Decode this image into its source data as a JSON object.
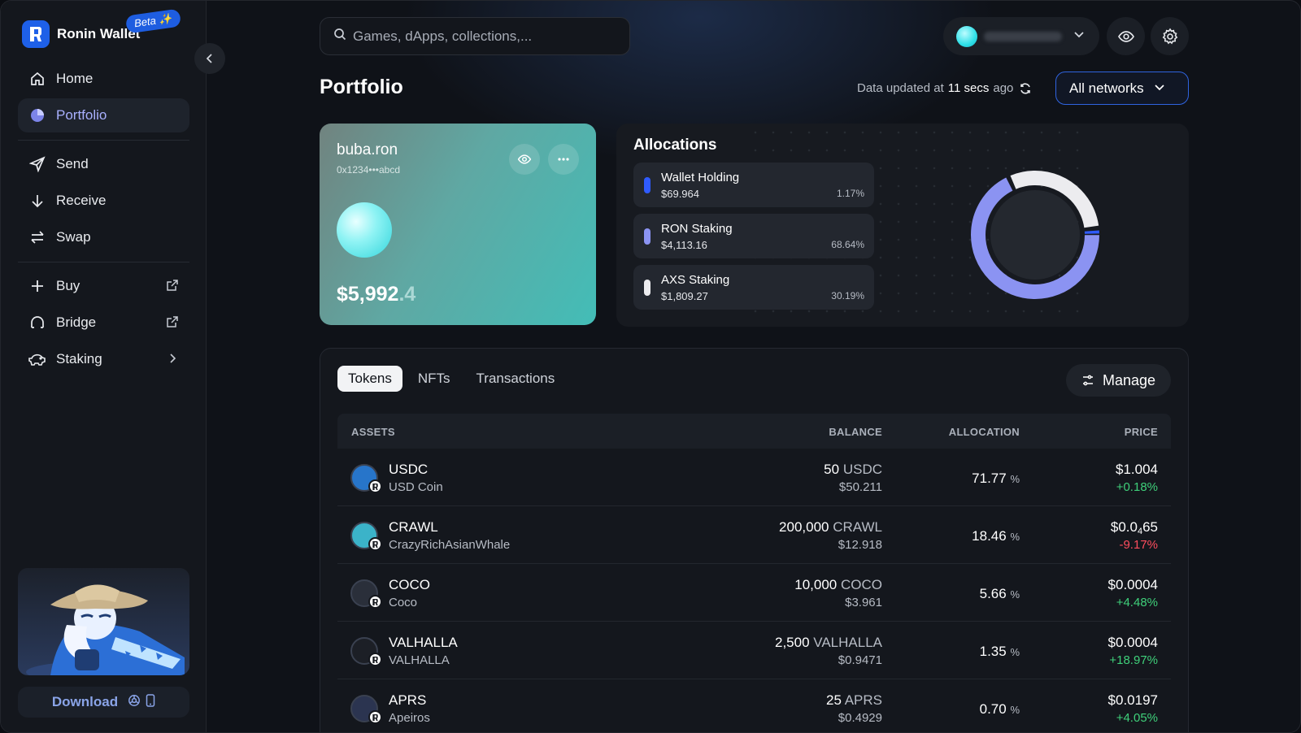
{
  "app": {
    "name": "Ronin Wallet",
    "beta": "Beta ✨"
  },
  "sidebar": {
    "items": [
      {
        "label": "Home",
        "icon": "home-icon"
      },
      {
        "label": "Portfolio",
        "icon": "pie-chart-icon",
        "active": true
      },
      {
        "label": "Send",
        "icon": "send-icon"
      },
      {
        "label": "Receive",
        "icon": "arrow-down-icon"
      },
      {
        "label": "Swap",
        "icon": "swap-icon"
      },
      {
        "label": "Buy",
        "icon": "plus-icon",
        "trail": "external-link-icon"
      },
      {
        "label": "Bridge",
        "icon": "bridge-icon",
        "trail": "external-link-icon"
      },
      {
        "label": "Staking",
        "icon": "piggy-bank-icon",
        "trail": "chevron-right-icon"
      }
    ],
    "download_label": "Download"
  },
  "topbar": {
    "search_placeholder": "Games, dApps, collections,..."
  },
  "page": {
    "title": "Portfolio",
    "updated_prefix": "Data updated at",
    "updated_value": "11 secs",
    "updated_suffix": "ago",
    "network_select": "All networks"
  },
  "account_card": {
    "name": "buba.ron",
    "address": "0x1234•••abcd",
    "balance_main": "$5,992",
    "balance_decimal": ".4"
  },
  "allocations": {
    "title": "Allocations",
    "items": [
      {
        "label": "Wallet Holding",
        "value": "$69.964",
        "percent": "1.17%",
        "fraction": 0.0117,
        "color": "#2f5bff"
      },
      {
        "label": "RON Staking",
        "value": "$4,113.16",
        "percent": "68.64%",
        "fraction": 0.6864,
        "color": "#8b93f2"
      },
      {
        "label": "AXS Staking",
        "value": "$1,809.27",
        "percent": "30.19%",
        "fraction": 0.3019,
        "color": "#ececef"
      }
    ]
  },
  "assets": {
    "tabs": [
      "Tokens",
      "NFTs",
      "Transactions"
    ],
    "manage_label": "Manage",
    "headers": {
      "assets": "ASSETS",
      "balance": "BALANCE",
      "allocation": "ALLOCATION",
      "price": "PRICE"
    },
    "rows": [
      {
        "symbol": "USDC",
        "name": "USD Coin",
        "amount": "50",
        "unit": "USDC",
        "usd": "$50.211",
        "alloc": "71.77",
        "pct": "%",
        "price": "$1.004",
        "change": "+0.18%",
        "dir": "up",
        "color": "#2775ca"
      },
      {
        "symbol": "CRAWL",
        "name": "CrazyRichAsianWhale",
        "amount": "200,000",
        "unit": "CRAWL",
        "usd": "$12.918",
        "alloc": "18.46",
        "pct": "%",
        "price_main": "$0.0",
        "price_sub": "4",
        "price_tail": "65",
        "change": "-9.17%",
        "dir": "down",
        "color": "#3bb3c9"
      },
      {
        "symbol": "COCO",
        "name": "Coco",
        "amount": "10,000",
        "unit": "COCO",
        "usd": "$3.961",
        "alloc": "5.66",
        "pct": "%",
        "price": "$0.0004",
        "change": "+4.48%",
        "dir": "up",
        "color": "#2a2f3a"
      },
      {
        "symbol": "VALHALLA",
        "name": "VALHALLA",
        "amount": "2,500",
        "unit": "VALHALLA",
        "usd": "$0.9471",
        "alloc": "1.35",
        "pct": "%",
        "price": "$0.0004",
        "change": "+18.97%",
        "dir": "up",
        "color": "#1c1f26"
      },
      {
        "symbol": "APRS",
        "name": "Apeiros",
        "amount": "25",
        "unit": "APRS",
        "usd": "$0.4929",
        "alloc": "0.70",
        "pct": "%",
        "price": "$0.0197",
        "change": "+4.05%",
        "dir": "up",
        "color": "#2b3450"
      }
    ]
  }
}
